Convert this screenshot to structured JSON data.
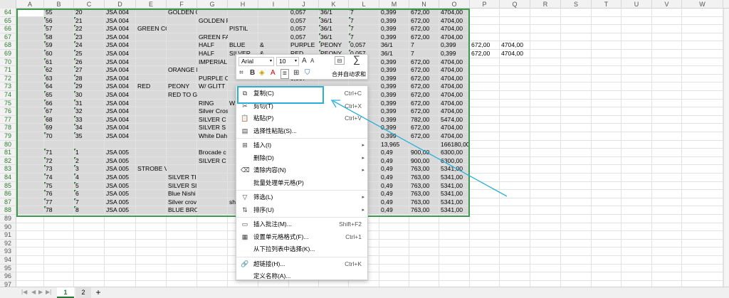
{
  "columns": [
    "A",
    "B",
    "C",
    "D",
    "E",
    "F",
    "G",
    "H",
    "I",
    "J",
    "K",
    "L",
    "M",
    "N",
    "O",
    "P",
    "Q",
    "R",
    "S",
    "T",
    "U",
    "V",
    "W"
  ],
  "rows": [
    {
      "n": "64",
      "c": {
        "B": "55",
        "C": "20",
        "D": "JSA 004",
        "F": "GOLDEN C",
        "J": "0,057",
        "K": "36/1",
        "L": "7",
        "M": "0,399",
        "N": "672,00",
        "O": "4704,00"
      }
    },
    {
      "n": "65",
      "c": {
        "B": "56",
        "C": "21",
        "D": "JSA 004",
        "G": "GOLDEN F",
        "J": "0,057",
        "K": "36/1",
        "L": "7",
        "M": "0,399",
        "N": "672,00",
        "O": "4704,00"
      }
    },
    {
      "n": "66",
      "c": {
        "B": "57",
        "C": "22",
        "D": "JSA 004",
        "E": "GREEN CC",
        "H": "PISTIL",
        "J": "0,057",
        "K": "36/1",
        "L": "7",
        "M": "0,399",
        "N": "672,00",
        "O": "4704,00"
      }
    },
    {
      "n": "67",
      "c": {
        "B": "58",
        "C": "23",
        "D": "JSA 004",
        "G": "GREEN FA",
        "J": "0,057",
        "K": "36/1",
        "L": "7",
        "M": "0,399",
        "N": "672,00",
        "O": "4704,00"
      }
    },
    {
      "n": "68",
      "c": {
        "B": "59",
        "C": "24",
        "D": "JSA 004",
        "G": "HALF",
        "H": "BLUE",
        "I": "&",
        "J": "PURPLE",
        "K": "PEONY",
        "L": "0,057",
        "M": "36/1",
        "N": "7",
        "O": "0,399",
        "P": "672,00",
        "Q": "4704,00"
      }
    },
    {
      "n": "69",
      "c": {
        "B": "60",
        "C": "25",
        "D": "JSA 004",
        "G": "HALF",
        "H": "SILVER",
        "I": "&",
        "J": "RED",
        "K": "PEONY",
        "L": "0,057",
        "M": "36/1",
        "N": "7",
        "O": "0,399",
        "P": "672,00",
        "Q": "4704,00"
      }
    },
    {
      "n": "70",
      "c": {
        "B": "61",
        "C": "26",
        "D": "JSA 004",
        "G": "IMPERIAL",
        "M": "0,399",
        "N": "672,00",
        "O": "4704,00"
      }
    },
    {
      "n": "71",
      "c": {
        "B": "62",
        "C": "27",
        "D": "JSA 004",
        "F": "ORANGE F",
        "M": "0,399",
        "N": "672,00",
        "O": "4704,00"
      }
    },
    {
      "n": "72",
      "c": {
        "B": "63",
        "C": "28",
        "D": "JSA 004",
        "G": "PURPLE C",
        "J": "0,057",
        "M": "0,399",
        "N": "672,00",
        "O": "4704,00"
      }
    },
    {
      "n": "73",
      "c": {
        "B": "64",
        "C": "29",
        "D": "JSA 004",
        "E": "RED",
        "F": "PEONY",
        "G": "W/ GLITT",
        "M": "0,399",
        "N": "672,00",
        "O": "4704,00"
      }
    },
    {
      "n": "74",
      "c": {
        "B": "65",
        "C": "30",
        "D": "JSA 004",
        "F": "RED TO G",
        "M": "0,399",
        "N": "672,00",
        "O": "4704,00"
      }
    },
    {
      "n": "75",
      "c": {
        "B": "66",
        "C": "31",
        "D": "JSA 004",
        "G": "RING",
        "H": "W",
        "M": "0,399",
        "N": "672,00",
        "O": "4704,00"
      }
    },
    {
      "n": "76",
      "c": {
        "B": "67",
        "C": "32",
        "D": "JSA 004",
        "G": "Silver Cros",
        "M": "0,399",
        "N": "672,00",
        "O": "4704,00"
      }
    },
    {
      "n": "77",
      "c": {
        "B": "68",
        "C": "33",
        "D": "JSA 004",
        "G": "SILVER C",
        "M": "0,399",
        "N": "782,00",
        "O": "5474,00"
      }
    },
    {
      "n": "78",
      "c": {
        "B": "69",
        "C": "34",
        "D": "JSA 004",
        "G": "SILVER S",
        "M": "0,399",
        "N": "672,00",
        "O": "4704,00"
      }
    },
    {
      "n": "79",
      "c": {
        "B": "70",
        "C": "35",
        "D": "JSA 004",
        "G": "White Dah",
        "M": "0,399",
        "N": "672,00",
        "O": "4704,00"
      }
    },
    {
      "n": "80",
      "c": {
        "M": "13,965",
        "O": "166180,00"
      }
    },
    {
      "n": "81",
      "c": {
        "B": "71",
        "C": "1",
        "D": "JSA 005",
        "G": "Brocade c",
        "M": "0,49",
        "N": "900,00",
        "O": "6300,00"
      }
    },
    {
      "n": "82",
      "c": {
        "B": "72",
        "C": "2",
        "D": "JSA 005",
        "G": "SILVER C",
        "M": "0,49",
        "N": "900,00",
        "O": "6300,00"
      }
    },
    {
      "n": "83",
      "c": {
        "B": "73",
        "C": "3",
        "D": "JSA 005",
        "E": "STROBE V",
        "M": "0,49",
        "N": "763,00",
        "O": "5341,00"
      }
    },
    {
      "n": "84",
      "c": {
        "B": "74",
        "C": "4",
        "D": "JSA 005",
        "F": "SILVER TI",
        "M": "0,49",
        "N": "763,00",
        "O": "5341,00"
      }
    },
    {
      "n": "85",
      "c": {
        "B": "75",
        "C": "5",
        "D": "JSA 005",
        "F": "SILVER SI",
        "M": "0,49",
        "N": "763,00",
        "O": "5341,00"
      }
    },
    {
      "n": "86",
      "c": {
        "B": "76",
        "C": "6",
        "D": "JSA 005",
        "F": "Blue Nishi",
        "M": "0,49",
        "N": "763,00",
        "O": "5341,00"
      }
    },
    {
      "n": "87",
      "c": {
        "B": "77",
        "C": "7",
        "D": "JSA 005",
        "F": "Silver crov",
        "H": "shi",
        "M": "0,49",
        "N": "763,00",
        "O": "5341,00"
      }
    },
    {
      "n": "88",
      "c": {
        "B": "78",
        "C": "8",
        "D": "JSA 005",
        "F": "BLUE BRO",
        "M": "0,49",
        "N": "763,00",
        "O": "5341,00"
      }
    },
    {
      "n": "89",
      "c": {}
    },
    {
      "n": "90",
      "c": {}
    },
    {
      "n": "91",
      "c": {}
    },
    {
      "n": "92",
      "c": {}
    },
    {
      "n": "93",
      "c": {}
    },
    {
      "n": "94",
      "c": {}
    },
    {
      "n": "95",
      "c": {}
    },
    {
      "n": "96",
      "c": {}
    },
    {
      "n": "97",
      "c": {}
    },
    {
      "n": "98",
      "c": {}
    }
  ],
  "minibar": {
    "font": "Arial",
    "size": "10",
    "merge": "合并",
    "autosum": "自动求和",
    "bold": "B",
    "grow_font": "A",
    "shrink_font": "A",
    "sum_symbol": "∑",
    "font_color_glyph": "A"
  },
  "context_menu": [
    {
      "icon": "copy-icon",
      "glyph": "⧉",
      "label": "复制(C)",
      "shortcut": "Ctrl+C"
    },
    {
      "icon": "cut-icon",
      "glyph": "✂",
      "label": "剪切(T)",
      "shortcut": "Ctrl+X"
    },
    {
      "icon": "paste-icon",
      "glyph": "📋",
      "label": "粘贴(P)",
      "shortcut": "Ctrl+V"
    },
    {
      "icon": "paste-special-icon",
      "glyph": "▤",
      "label": "选择性粘贴(S)...",
      "shortcut": ""
    },
    {
      "sep": true
    },
    {
      "icon": "insert-icon",
      "glyph": "⊞",
      "label": "插入(I)",
      "shortcut": "",
      "sub": true
    },
    {
      "icon": "",
      "glyph": "",
      "label": "删除(D)",
      "shortcut": "",
      "sub": true
    },
    {
      "icon": "clear-icon",
      "glyph": "⌫",
      "label": "清除内容(N)",
      "shortcut": "",
      "sub": true
    },
    {
      "icon": "",
      "glyph": "",
      "label": "批量处理单元格(P)",
      "shortcut": ""
    },
    {
      "sep": true
    },
    {
      "icon": "filter-icon",
      "glyph": "▽",
      "label": "筛选(L)",
      "shortcut": "",
      "sub": true
    },
    {
      "icon": "sort-icon",
      "glyph": "⇅",
      "label": "排序(U)",
      "shortcut": "",
      "sub": true
    },
    {
      "sep": true
    },
    {
      "icon": "comment-icon",
      "glyph": "▭",
      "label": "插入批注(M)...",
      "shortcut": "Shift+F2"
    },
    {
      "icon": "format-cells-icon",
      "glyph": "▦",
      "label": "设置单元格格式(F)...",
      "shortcut": "Ctrl+1"
    },
    {
      "icon": "",
      "glyph": "",
      "label": "从下拉列表中选择(K)...",
      "shortcut": ""
    },
    {
      "sep": true
    },
    {
      "icon": "link-icon",
      "glyph": "🔗",
      "label": "超链接(H)...",
      "shortcut": "Ctrl+K"
    },
    {
      "icon": "",
      "glyph": "",
      "label": "定义名称(A)...",
      "shortcut": ""
    }
  ],
  "tabs": {
    "items": [
      "1",
      "2"
    ],
    "active": "1",
    "add": "+"
  },
  "colors": {
    "selection": "#d9d9d9",
    "selection_border": "#3a9a4e",
    "annotation": "#29b0d8",
    "row_header_selected": "#2e7d32"
  }
}
